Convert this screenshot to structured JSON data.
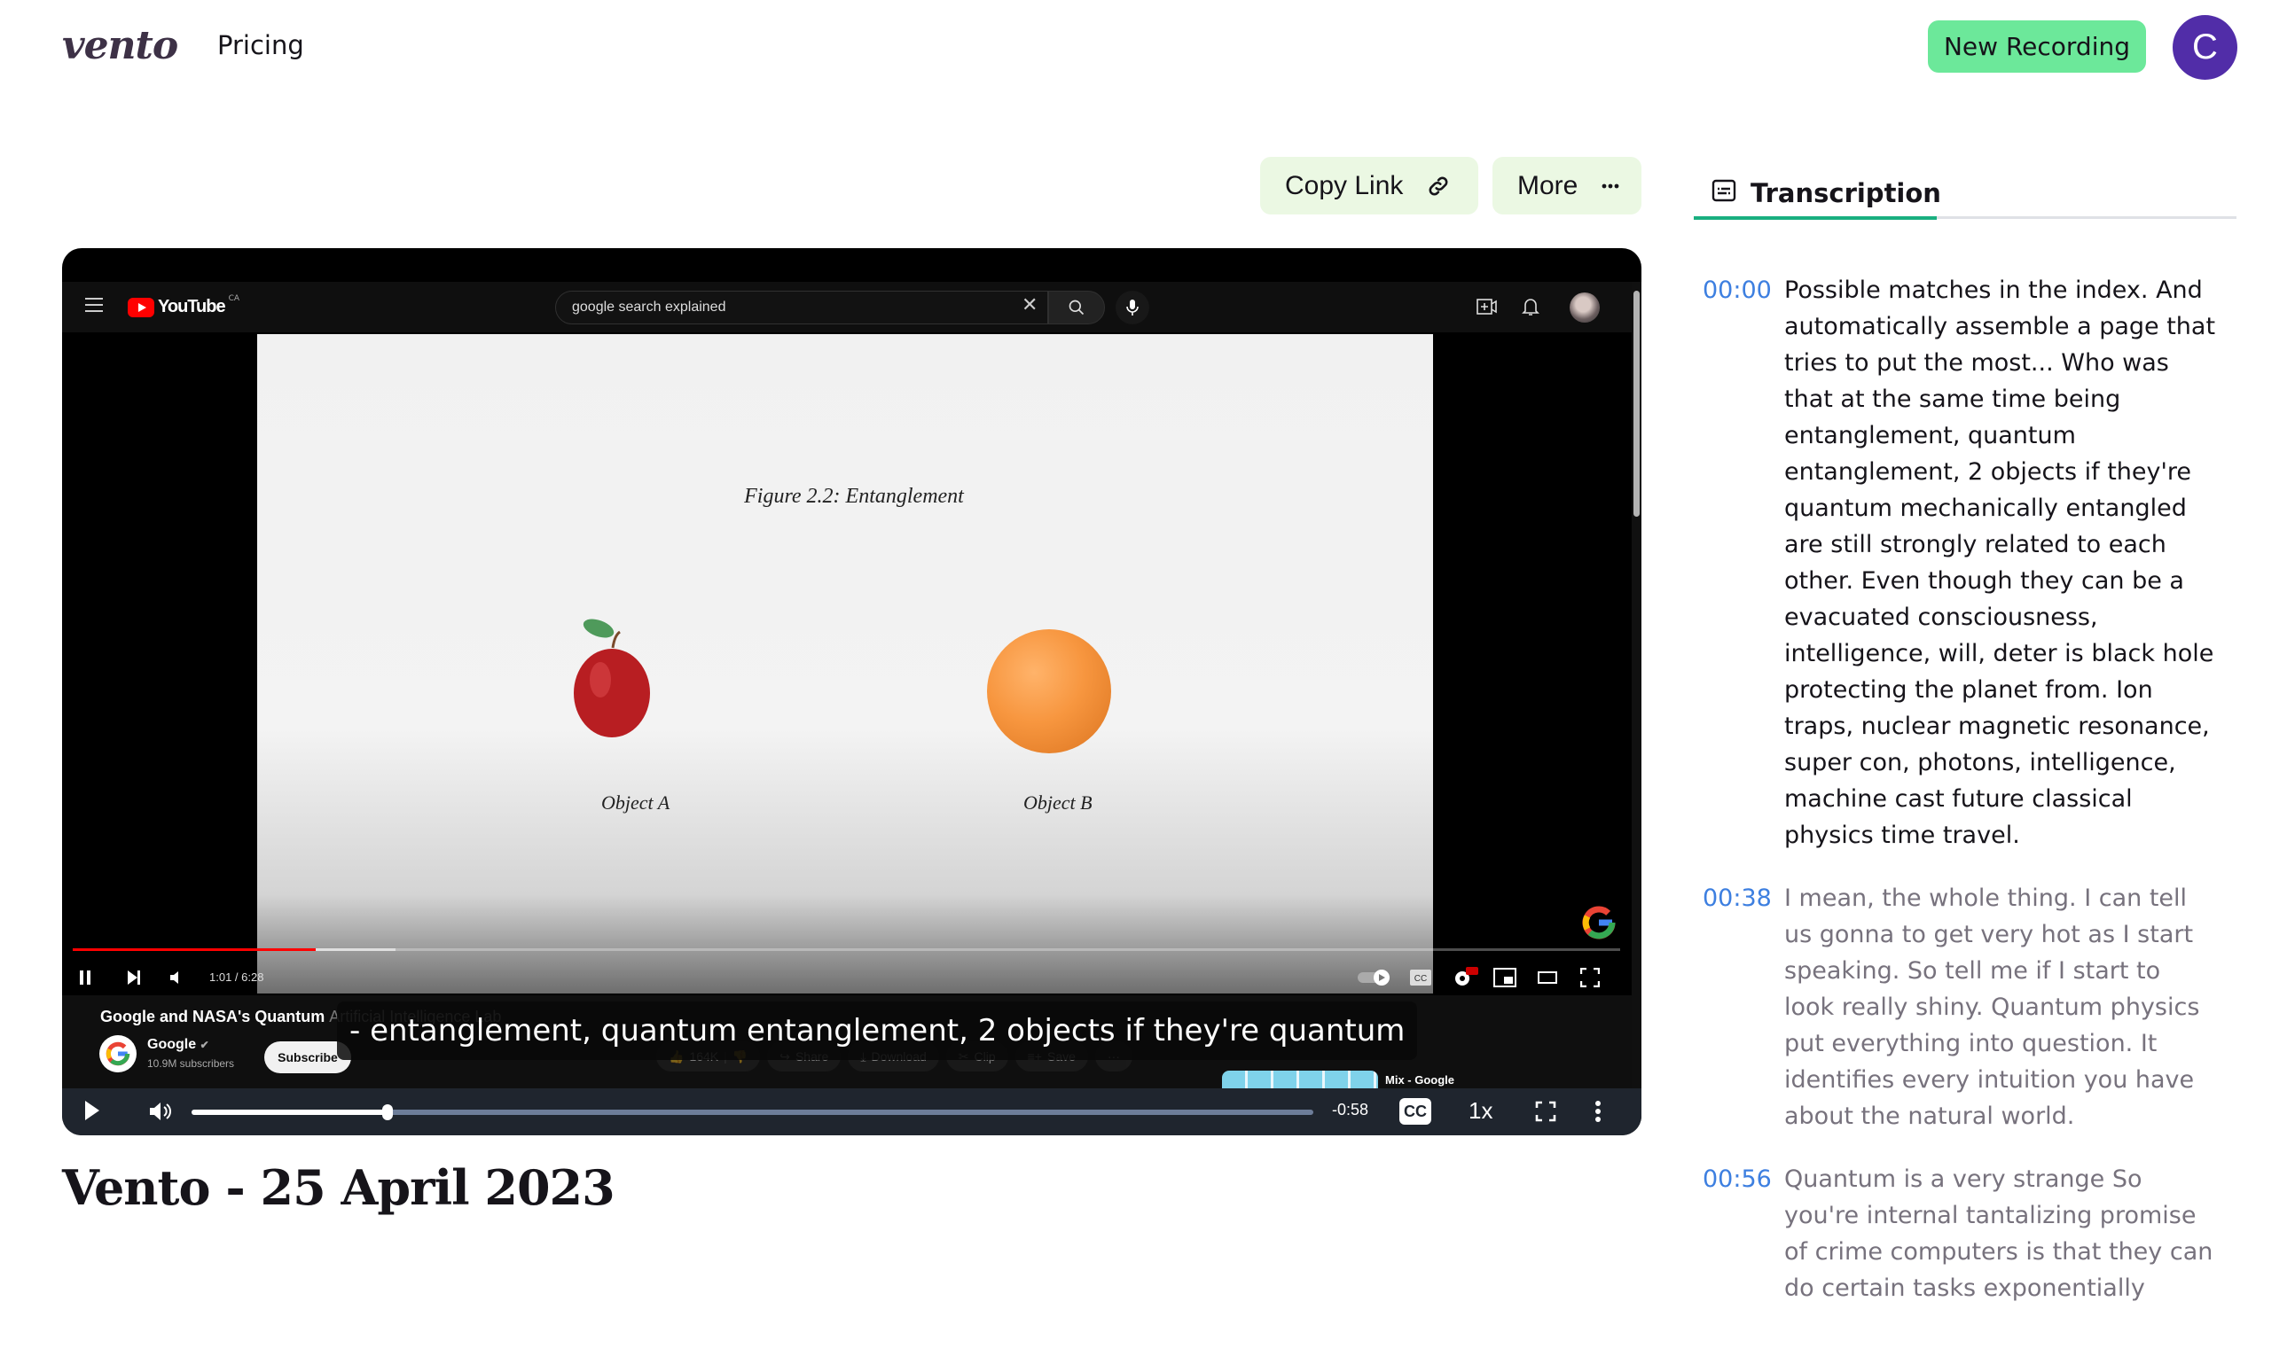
{
  "nav": {
    "logo": "vento",
    "links": [
      {
        "label": "Pricing"
      }
    ],
    "new_recording_label": "New Recording",
    "avatar_initial": "C"
  },
  "actions": {
    "copy_link_label": "Copy Link",
    "more_label": "More"
  },
  "recording": {
    "title": "Vento - 25 April 2023"
  },
  "player": {
    "embedded_page": {
      "site": "YouTube",
      "region": "CA",
      "search_value": "google search explained",
      "slide": {
        "figure_title": "Figure 2.2: Entanglement",
        "object_a": "Object A",
        "object_b": "Object B"
      },
      "inner_time": "1:01 / 6:28",
      "inner_progress_fraction": 0.157,
      "video_title_main": "Google and NASA's Quantum ",
      "video_title_rest": "Artificial Intelligence Lab",
      "channel_name": "Google",
      "channel_subs": "10.9M subscribers",
      "subscribe_label": "Subscribe",
      "likes": "164K",
      "share_label": "Share",
      "download_label": "Download",
      "clip_label": "Clip",
      "save_label": "Save",
      "mix_label": "Mix - Google"
    },
    "caption": "- entanglement, quantum entanglement, 2 objects if they're quantum",
    "controls": {
      "progress_fraction": 0.175,
      "remaining_time": "-0:58",
      "cc_label": "CC",
      "speed_label": "1x"
    }
  },
  "transcription": {
    "tab_label": "Transcription",
    "entries": [
      {
        "timestamp": "00:00",
        "text": "Possible matches in the index. And automatically assemble a page that tries to put the most... Who was that at the same time being entanglement, quantum entanglement, 2 objects if they're quantum mechanically entangled are still strongly related to each other. Even though they can be a evacuated consciousness, intelligence, will, deter is black hole protecting the planet from. Ion traps, nuclear magnetic resonance, super con, photons, intelligence, machine cast future classical physics time travel.",
        "state": "current"
      },
      {
        "timestamp": "00:38",
        "text": "I mean, the whole thing. I can tell us gonna to get very hot as I start speaking. So tell me if I start to look really shiny. Quantum physics put everything into question. It identifies every intuition you have about the natural world.",
        "state": "past"
      },
      {
        "timestamp": "00:56",
        "text": "Quantum is a very strange So you're internal tantalizing promise of crime computers is that they can do certain tasks exponentially",
        "state": "past"
      }
    ]
  },
  "colors": {
    "brand": "#3d3146",
    "new_recording_bg": "#6ce89a",
    "avatar_bg": "#512da8",
    "action_bg": "#ebf8e3",
    "tab_active": "#1aaf80",
    "timestamp": "#3d7fe0",
    "player_controls_bg": "#1f252e"
  }
}
